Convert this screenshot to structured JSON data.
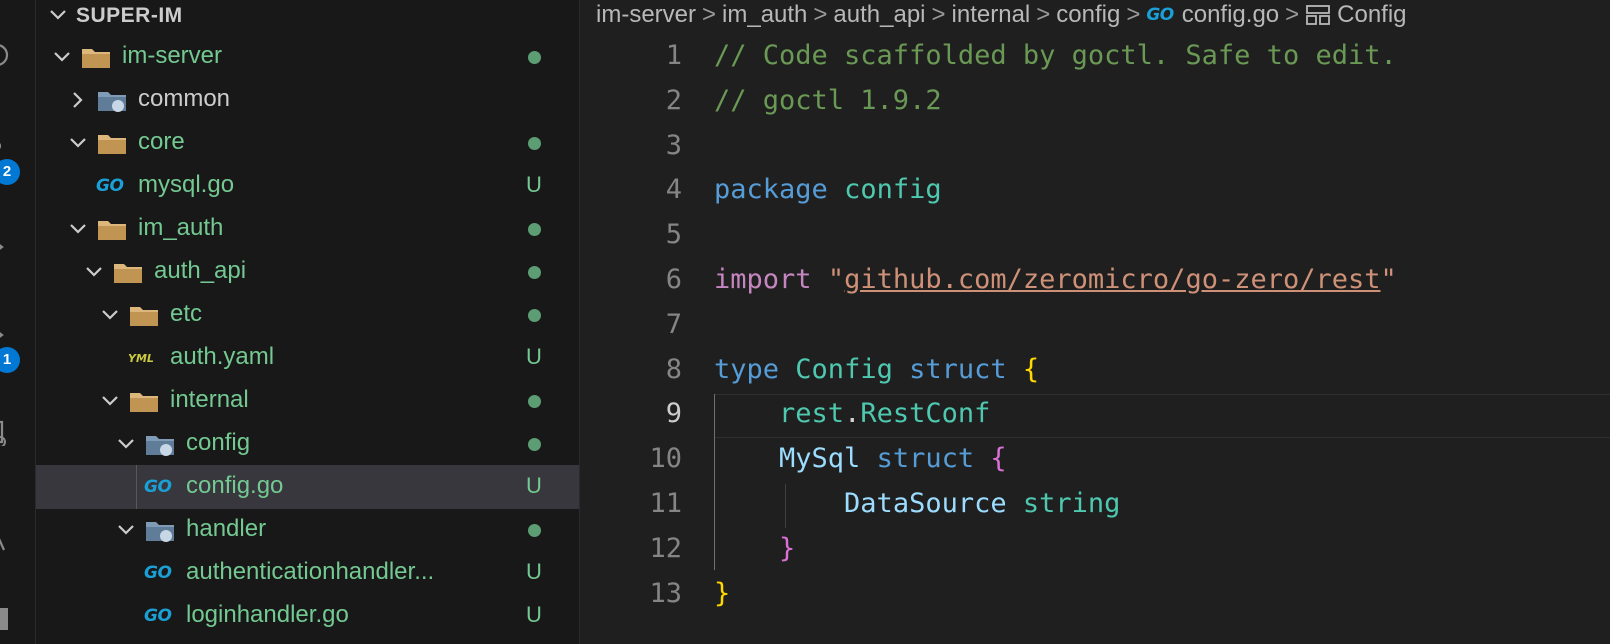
{
  "explorer": {
    "title": "SUPER-IM",
    "items": [
      {
        "label": "im-server",
        "kind": "folder",
        "expanded": true,
        "status": "dot",
        "color": "#73c991"
      },
      {
        "label": "common",
        "kind": "folder-special",
        "expanded": false,
        "status": "",
        "color": "#cccccc"
      },
      {
        "label": "core",
        "kind": "folder",
        "expanded": true,
        "status": "dot",
        "color": "#73c991"
      },
      {
        "label": "mysql.go",
        "kind": "go-file",
        "status": "U",
        "color": "#73c991"
      },
      {
        "label": "im_auth",
        "kind": "folder",
        "expanded": true,
        "status": "dot",
        "color": "#73c991"
      },
      {
        "label": "auth_api",
        "kind": "folder",
        "expanded": true,
        "status": "dot",
        "color": "#73c991"
      },
      {
        "label": "etc",
        "kind": "folder",
        "expanded": true,
        "status": "dot",
        "color": "#73c991"
      },
      {
        "label": "auth.yaml",
        "kind": "yaml-file",
        "status": "U",
        "color": "#73c991"
      },
      {
        "label": "internal",
        "kind": "folder",
        "expanded": true,
        "status": "dot",
        "color": "#73c991"
      },
      {
        "label": "config",
        "kind": "folder-special",
        "expanded": true,
        "status": "dot",
        "color": "#73c991"
      },
      {
        "label": "config.go",
        "kind": "go-file",
        "status": "U",
        "color": "#73c991",
        "selected": true
      },
      {
        "label": "handler",
        "kind": "folder-special",
        "expanded": true,
        "status": "dot",
        "color": "#73c991"
      },
      {
        "label": "authenticationhandler...",
        "kind": "go-file",
        "status": "U",
        "color": "#73c991"
      },
      {
        "label": "loginhandler.go",
        "kind": "go-file",
        "status": "U",
        "color": "#73c991"
      }
    ]
  },
  "activity": {
    "badges": [
      "2",
      "1"
    ]
  },
  "breadcrumb": [
    "im-server",
    "im_auth",
    "auth_api",
    "internal",
    "config",
    "config.go",
    "Config"
  ],
  "go_icon_text": "GO",
  "yaml_icon_text": "YML",
  "editor": {
    "active_line": 9,
    "lines": [
      [
        {
          "t": "// Code scaffolded by goctl. Safe to edit.",
          "c": "comment"
        }
      ],
      [
        {
          "t": "// goctl 1.9.2",
          "c": "comment"
        }
      ],
      [],
      [
        {
          "t": "package",
          "c": "keyword"
        },
        {
          "t": " ",
          "c": "plain"
        },
        {
          "t": "config",
          "c": "pkg"
        }
      ],
      [],
      [
        {
          "t": "import",
          "c": "import"
        },
        {
          "t": " ",
          "c": "plain"
        },
        {
          "t": "\"",
          "c": "string"
        },
        {
          "t": "github.com/zeromicro/go-zero/rest",
          "c": "string url"
        },
        {
          "t": "\"",
          "c": "string"
        }
      ],
      [],
      [
        {
          "t": "type",
          "c": "keyword"
        },
        {
          "t": " ",
          "c": "plain"
        },
        {
          "t": "Config",
          "c": "type"
        },
        {
          "t": " ",
          "c": "plain"
        },
        {
          "t": "struct",
          "c": "keyword"
        },
        {
          "t": " ",
          "c": "plain"
        },
        {
          "t": "{",
          "c": "brace1"
        }
      ],
      [
        {
          "t": "    ",
          "c": "plain"
        },
        {
          "t": "rest",
          "c": "pkg"
        },
        {
          "t": ".",
          "c": "plain"
        },
        {
          "t": "RestConf",
          "c": "type"
        }
      ],
      [
        {
          "t": "    ",
          "c": "plain"
        },
        {
          "t": "MySql",
          "c": "field"
        },
        {
          "t": " ",
          "c": "plain"
        },
        {
          "t": "struct",
          "c": "keyword"
        },
        {
          "t": " ",
          "c": "plain"
        },
        {
          "t": "{",
          "c": "brace2"
        }
      ],
      [
        {
          "t": "        ",
          "c": "plain"
        },
        {
          "t": "DataSource",
          "c": "field"
        },
        {
          "t": " ",
          "c": "plain"
        },
        {
          "t": "string",
          "c": "type"
        }
      ],
      [
        {
          "t": "    ",
          "c": "plain"
        },
        {
          "t": "}",
          "c": "brace2"
        }
      ],
      [
        {
          "t": "}",
          "c": "brace1"
        }
      ]
    ]
  }
}
